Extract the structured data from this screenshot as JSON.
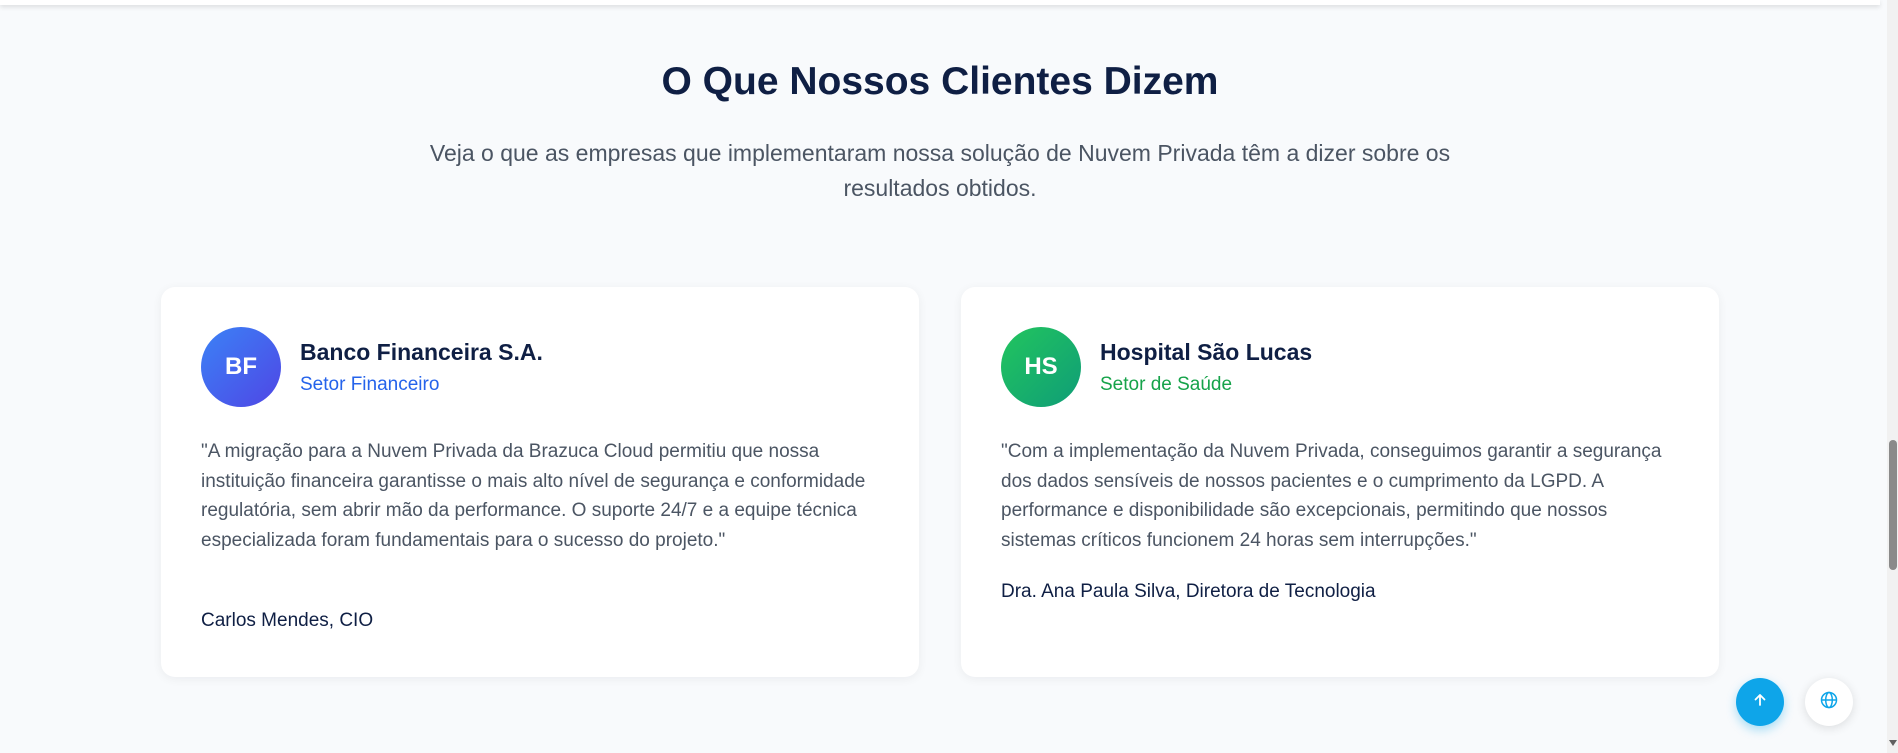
{
  "section": {
    "title": "O Que Nossos Clientes Dizem",
    "subtitle": "Veja o que as empresas que implementaram nossa solução de Nuvem Privada têm a dizer sobre os resultados obtidos."
  },
  "testimonials": [
    {
      "initials": "BF",
      "company": "Banco Financeira S.A.",
      "sector": "Setor Financeiro",
      "quote": "\"A migração para a Nuvem Privada da Brazuca Cloud permitiu que nossa instituição financeira garantisse o mais alto nível de segurança e conformidade regulatória, sem abrir mão da performance. O suporte 24/7 e a equipe técnica especializada foram fundamentais para o sucesso do projeto.\"",
      "author": "Carlos Mendes, CIO",
      "accent_color": "#2563eb"
    },
    {
      "initials": "HS",
      "company": "Hospital São Lucas",
      "sector": "Setor de Saúde",
      "quote": "\"Com a implementação da Nuvem Privada, conseguimos garantir a segurança dos dados sensíveis de nossos pacientes e o cumprimento da LGPD. A performance e disponibilidade são excepcionais, permitindo que nossos sistemas críticos funcionem 24 horas sem interrupções.\"",
      "author": "Dra. Ana Paula Silva, Diretora de Tecnologia",
      "accent_color": "#16a34a"
    }
  ],
  "floating_buttons": {
    "scroll_top_icon": "arrow-up-icon",
    "language_icon": "globe-icon",
    "primary_color": "#0ea5e9"
  },
  "colors": {
    "heading": "#0f1f44",
    "body_text": "#4b5563",
    "background": "#f8fafc"
  }
}
